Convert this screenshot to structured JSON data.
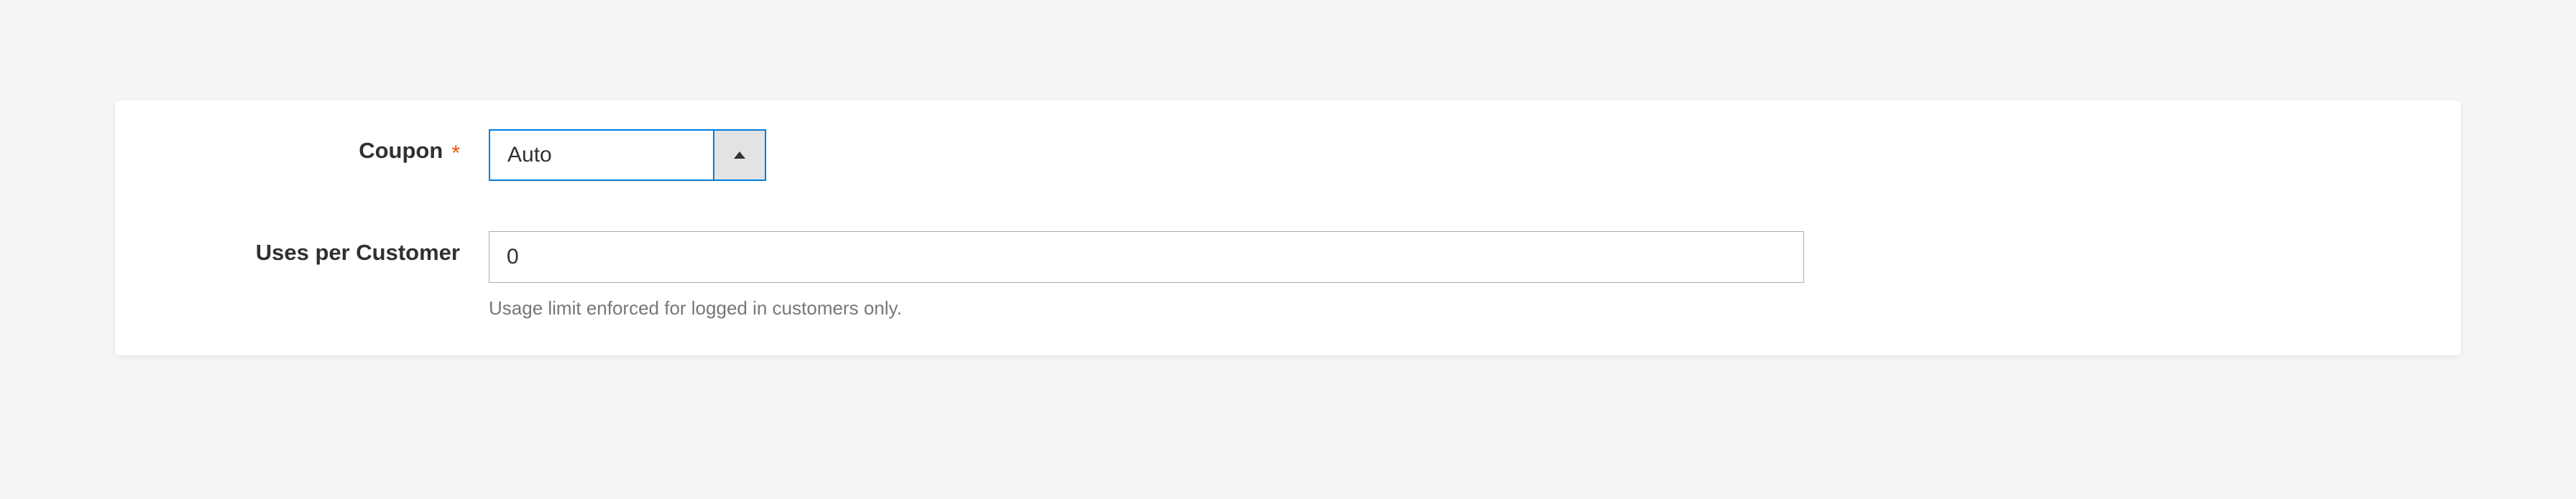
{
  "form": {
    "coupon": {
      "label": "Coupon",
      "required": true,
      "selected": "Auto"
    },
    "uses_per_customer": {
      "label": "Uses per Customer",
      "value": "0",
      "help": "Usage limit enforced for logged in customers only."
    }
  }
}
